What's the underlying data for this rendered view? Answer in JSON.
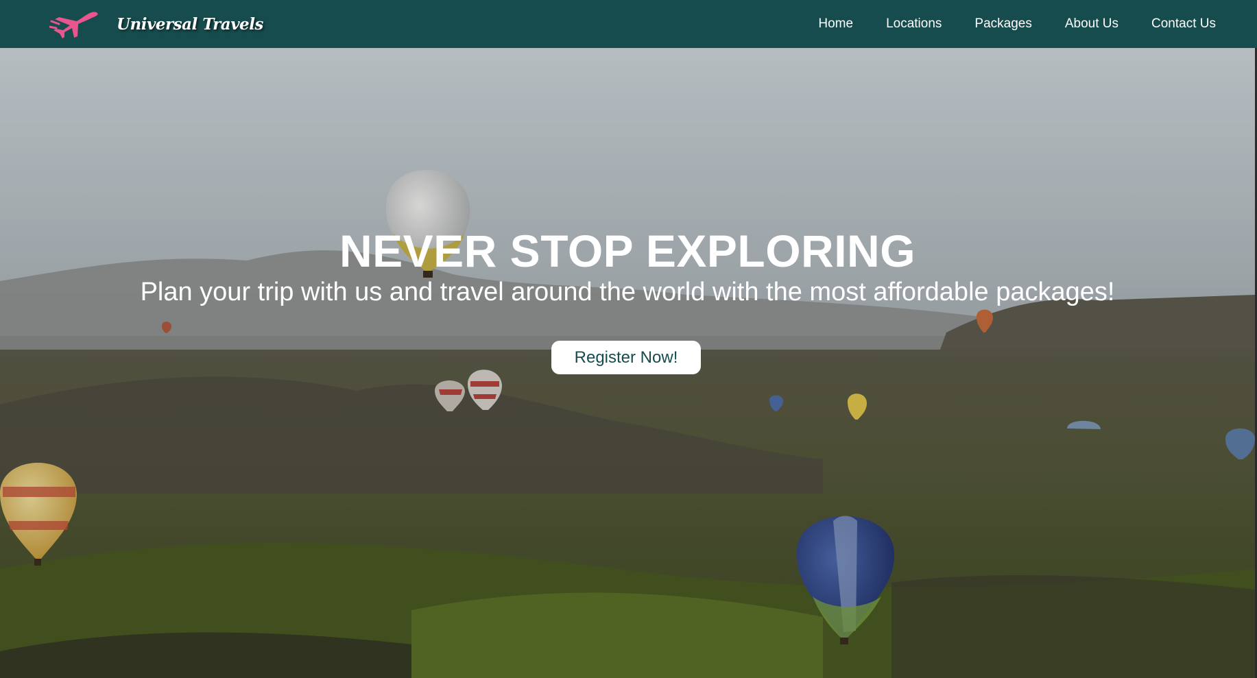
{
  "brand": {
    "name": "Universal Travels",
    "logo_icon": "airplane-icon",
    "logo_color": "#e8558f"
  },
  "nav": {
    "items": [
      {
        "label": "Home"
      },
      {
        "label": "Locations"
      },
      {
        "label": "Packages"
      },
      {
        "label": "About Us"
      },
      {
        "label": "Contact Us"
      }
    ]
  },
  "hero": {
    "title": "NEVER STOP EXPLORING",
    "subtitle": "Plan your trip with us and travel around the world with the most affordable packages!",
    "cta_label": "Register Now!",
    "background_image": "hot-air-balloons-landscape"
  },
  "colors": {
    "navbar": "#164c4d",
    "accent": "#e8558f",
    "cta_text": "#164c4d"
  }
}
